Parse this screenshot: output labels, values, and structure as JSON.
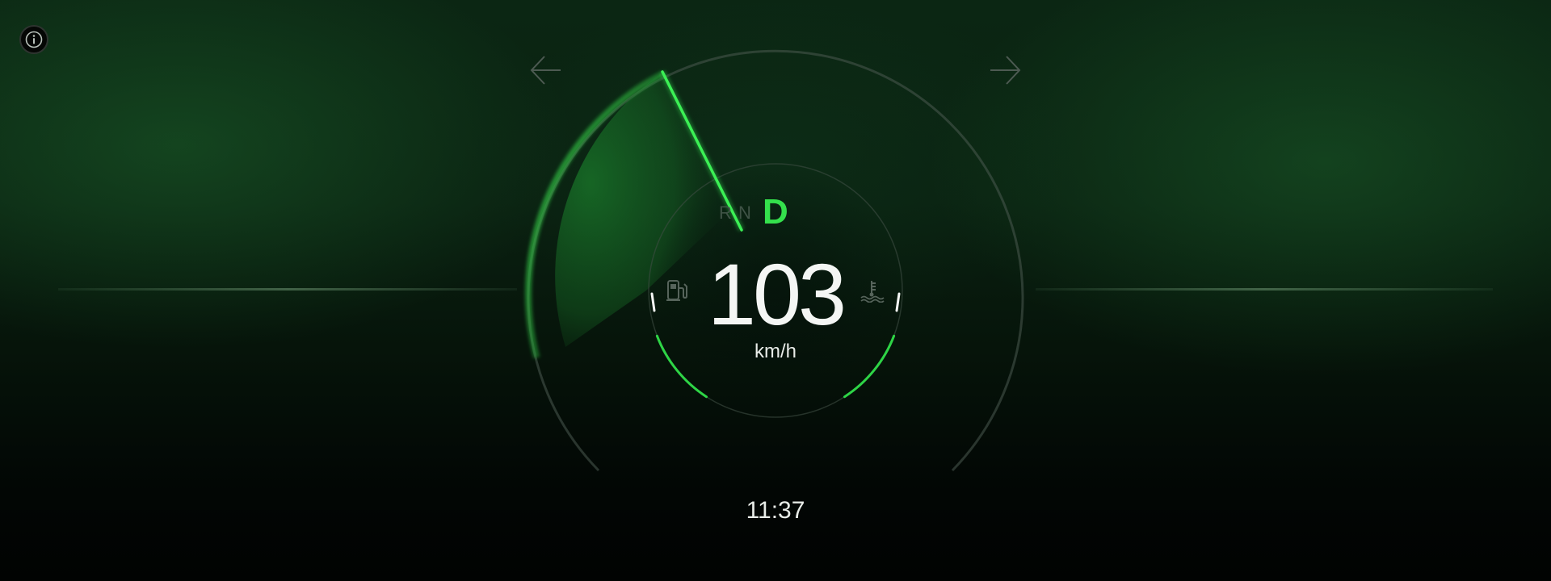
{
  "header": {
    "info_icon": "info-icon",
    "prev_icon": "arrow-left-icon",
    "next_icon": "arrow-right-icon"
  },
  "gear": {
    "options": [
      "R",
      "N",
      "D"
    ],
    "selected": "D"
  },
  "speed": {
    "value": "103",
    "unit": "km/h"
  },
  "fuel": {
    "icon": "fuel-pump-icon",
    "level": 0.75
  },
  "temperature": {
    "icon": "coolant-temperature-icon",
    "level": 0.75
  },
  "clock": {
    "time": "11:37"
  },
  "colors": {
    "accent": "#34e04c",
    "text": "#f4f6f4",
    "background": "#020604"
  }
}
